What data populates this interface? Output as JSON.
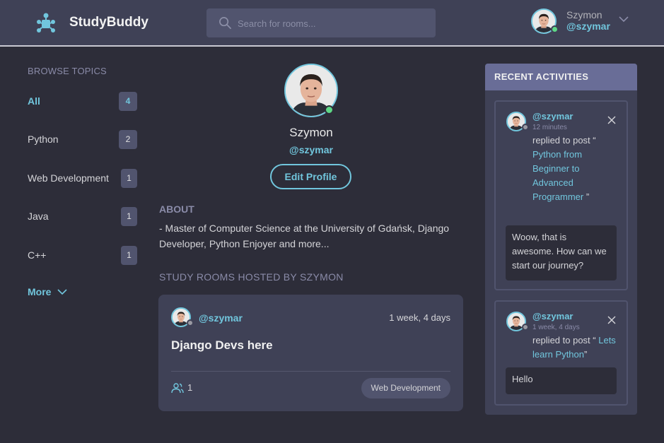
{
  "header": {
    "app_name": "StudyBuddy",
    "search_placeholder": "Search for rooms...",
    "user_name": "Szymon",
    "user_handle": "@szymar"
  },
  "sidebar": {
    "title": "BROWSE TOPICS",
    "topics": [
      {
        "label": "All",
        "count": "4"
      },
      {
        "label": "Python",
        "count": "2"
      },
      {
        "label": "Web Development",
        "count": "1"
      },
      {
        "label": "Java",
        "count": "1"
      },
      {
        "label": "C++",
        "count": "1"
      }
    ],
    "more_label": "More"
  },
  "profile": {
    "name": "Szymon",
    "handle": "@szymar",
    "edit_label": "Edit Profile",
    "about_title": "ABOUT",
    "about_text": "- Master of Computer Science at the University of Gdańsk, Django Developer, Python Enjoyer and more...",
    "rooms_title": "STUDY ROOMS HOSTED BY SZYMON"
  },
  "room": {
    "host": "@szymar",
    "time": "1 week, 4 days",
    "title": "Django Devs here",
    "participants": "1",
    "topic": "Web Development"
  },
  "activities": {
    "title": "RECENT ACTIVITIES",
    "items": [
      {
        "handle": "@szymar",
        "time": "12 minutes",
        "action": "replied to post “",
        "post": "Python from Beginner to Advanced Programmer",
        "close_quote": "”",
        "comment": "Woow, that is awesome. How can we start our journey?"
      },
      {
        "handle": "@szymar",
        "time": "1 week, 4 days",
        "action": "replied to post “",
        "post": "Lets learn Python",
        "close_quote": "”",
        "comment": "Hello"
      }
    ]
  },
  "colors": {
    "accent": "#71c6dd",
    "background": "#2d2d39",
    "card": "#3f4156",
    "online": "#5ed886",
    "offline": "#9a9aa3"
  }
}
